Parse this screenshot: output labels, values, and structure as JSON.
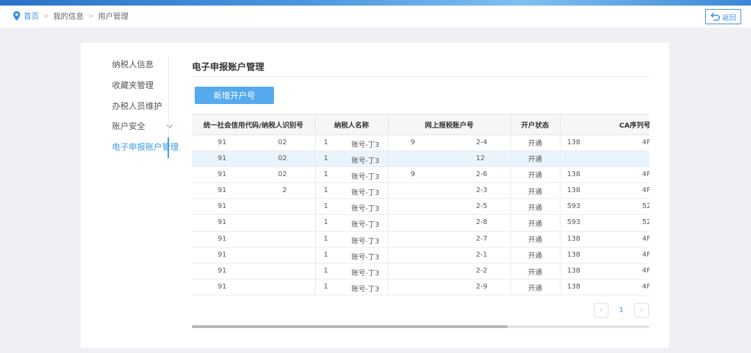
{
  "breadcrumb": {
    "home": "首页",
    "items": [
      "我的信息",
      "用户管理"
    ]
  },
  "header": {
    "back_label": "返回"
  },
  "sidebar": {
    "items": [
      {
        "label": "纳税人信息"
      },
      {
        "label": "收藏夹管理"
      },
      {
        "label": "办税人员维护"
      },
      {
        "label": "账户安全"
      },
      {
        "label": "电子申报账户管理"
      }
    ],
    "active_index": 4
  },
  "main": {
    "title": "电子申报账户管理",
    "add_button": "新增开户号",
    "table": {
      "headers": [
        "统一社会信用代码/纳税人识别号",
        "纳税人名称",
        "网上报税账户号",
        "开户状态",
        "CA序列号"
      ],
      "rows": [
        {
          "id_a": "91",
          "id_b": "02",
          "n_a": "1",
          "n_b": "账号-丁3",
          "acct_a": "9",
          "acct_b": "2-4",
          "status": "开通",
          "ca_a": "138",
          "ca_b": "4F"
        },
        {
          "id_a": "91",
          "id_b": "02",
          "n_a": "1",
          "n_b": "账号-丁3",
          "acct_a": "",
          "acct_b": "12",
          "status": "开通",
          "ca_a": "",
          "ca_b": ""
        },
        {
          "id_a": "91",
          "id_b": "02",
          "n_a": "1",
          "n_b": "账号-丁3",
          "acct_a": "9",
          "acct_b": "2-6",
          "status": "开通",
          "ca_a": "138",
          "ca_b": "4F"
        },
        {
          "id_a": "91",
          "id_b": "2",
          "n_a": "1",
          "n_b": "账号-丁3",
          "acct_a": "",
          "acct_b": "2-3",
          "status": "开通",
          "ca_a": "138",
          "ca_b": "4F"
        },
        {
          "id_a": "91",
          "id_b": "",
          "n_a": "1",
          "n_b": "账号-丁3",
          "acct_a": "",
          "acct_b": "2-5",
          "status": "开通",
          "ca_a": "593",
          "ca_b": "52"
        },
        {
          "id_a": "91",
          "id_b": "",
          "n_a": "1",
          "n_b": "账号-丁3",
          "acct_a": "",
          "acct_b": "2-8",
          "status": "开通",
          "ca_a": "593",
          "ca_b": "52"
        },
        {
          "id_a": "91",
          "id_b": "",
          "n_a": "1",
          "n_b": "账号-丁3",
          "acct_a": "",
          "acct_b": "2-7",
          "status": "开通",
          "ca_a": "138",
          "ca_b": "4F"
        },
        {
          "id_a": "91",
          "id_b": "",
          "n_a": "1",
          "n_b": "账号-丁3",
          "acct_a": "",
          "acct_b": "2-1",
          "status": "开通",
          "ca_a": "138",
          "ca_b": "4F"
        },
        {
          "id_a": "91",
          "id_b": "",
          "n_a": "1",
          "n_b": "账号-丁3",
          "acct_a": "",
          "acct_b": "2-2",
          "status": "开通",
          "ca_a": "138",
          "ca_b": "4F"
        },
        {
          "id_a": "91",
          "id_b": "",
          "n_a": "1",
          "n_b": "账号-丁3",
          "acct_a": "",
          "acct_b": "2-9",
          "status": "开通",
          "ca_a": "138",
          "ca_b": "4F"
        }
      ],
      "selected_row": 1
    },
    "pagination": {
      "current": "1",
      "prev": "‹",
      "next": "›"
    }
  },
  "colors": {
    "accent": "#3d9be6",
    "button": "#55aaee"
  }
}
